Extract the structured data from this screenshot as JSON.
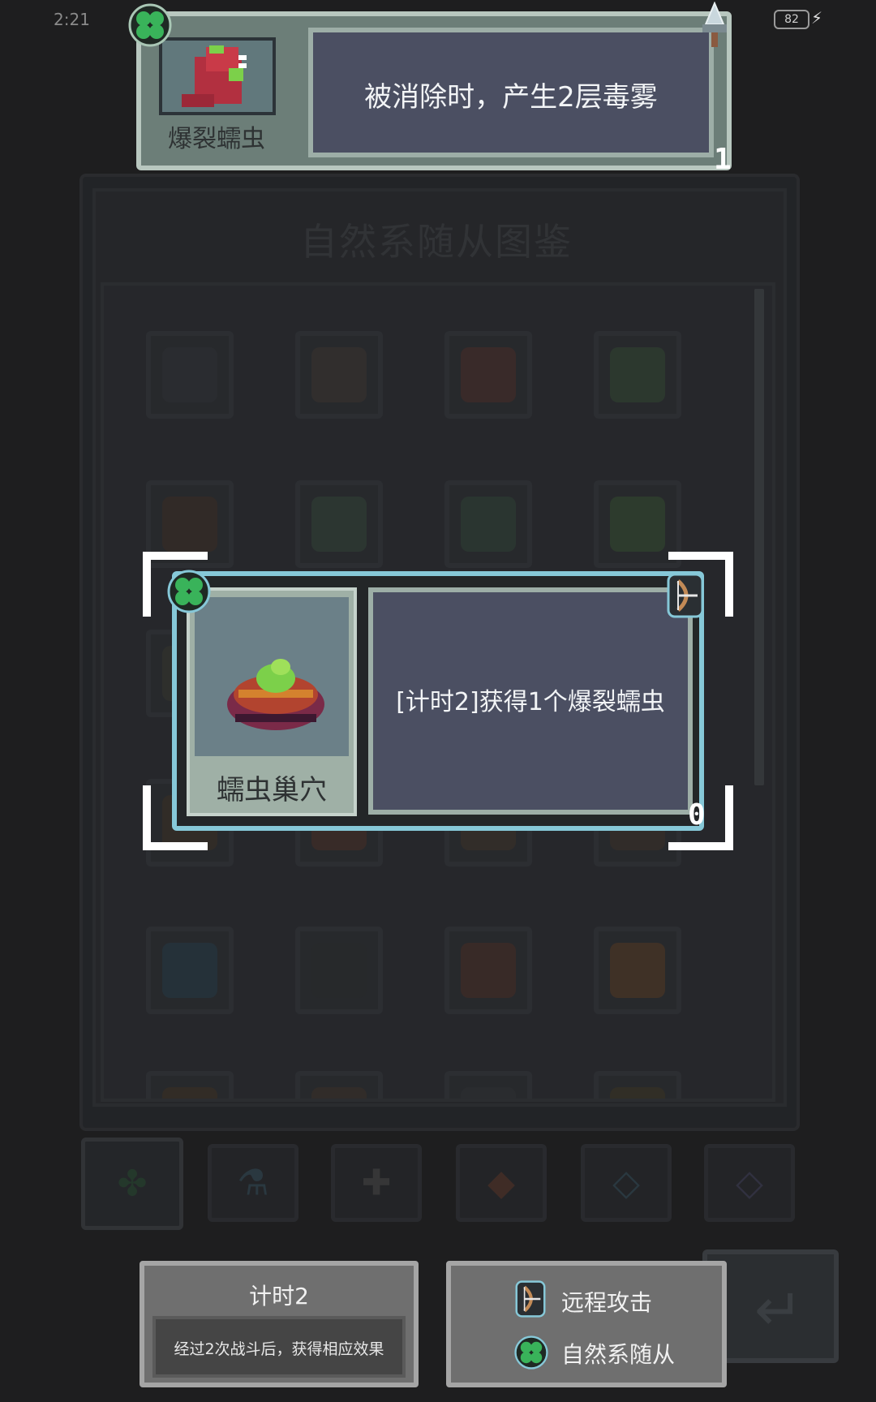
{
  "status_bar": {
    "time": "2:21",
    "battery": "82"
  },
  "codex": {
    "title": "自然系随从图鉴",
    "tabs": [
      "clover-icon",
      "flask-icon",
      "bone-icon",
      "fox-icon",
      "diamond-icon",
      "diamond-icon"
    ]
  },
  "top_card": {
    "name": "爆裂蠕虫",
    "description": "被消除时，产生2层毒雾",
    "counter": "1",
    "type_icon": "clover-icon",
    "attack_icon": "sword-icon"
  },
  "focus_card": {
    "name": "蠕虫巢穴",
    "description": "[计时2]获得1个爆裂蠕虫",
    "counter": "0",
    "type_icon": "clover-icon",
    "attack_icon": "bow-icon"
  },
  "timer_box": {
    "title": "计时2",
    "text": "经过2次战斗后，获得相应效果"
  },
  "legend_box": {
    "items": [
      {
        "icon": "bow-icon",
        "label": "远程攻击"
      },
      {
        "icon": "clover-icon",
        "label": "自然系随从"
      }
    ]
  },
  "colors": {
    "accent_border": "#86c8d8",
    "desc_panel": "#4b4f62",
    "clover": "#39b35a"
  }
}
